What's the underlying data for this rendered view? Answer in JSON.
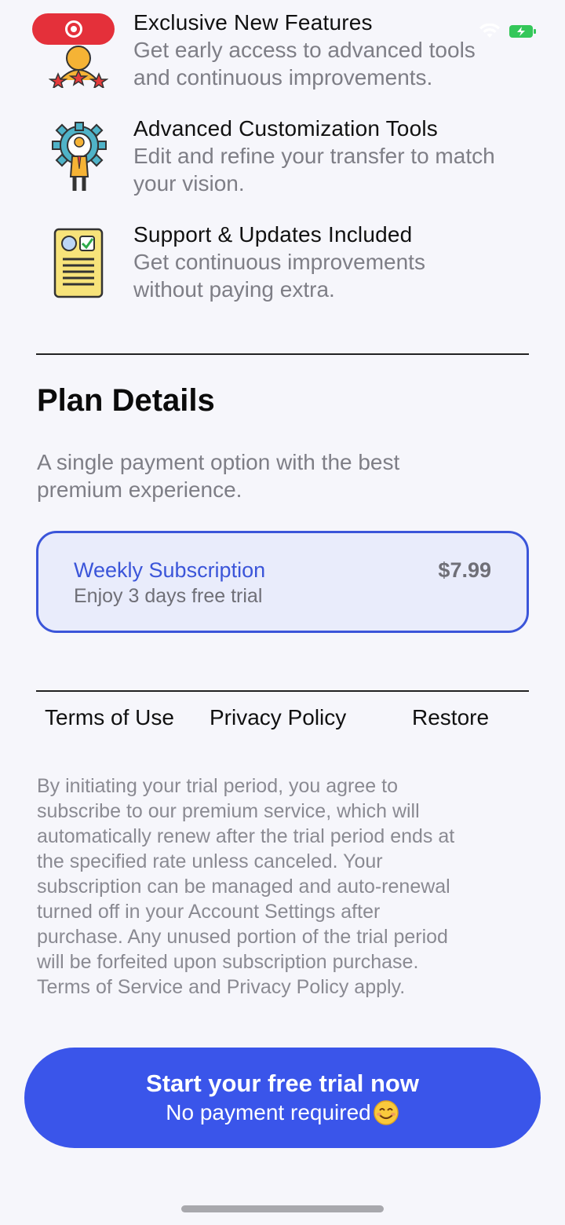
{
  "features": [
    {
      "icon": "award-person-icon",
      "title": "Exclusive New Features",
      "description_lines": [
        "Get early access to advanced tools",
        "and continuous improvements."
      ]
    },
    {
      "icon": "gear-person-icon",
      "title": "Advanced Customization Tools",
      "description_lines": [
        "Edit and refine your transfer to match",
        "your vision."
      ]
    },
    {
      "icon": "document-check-icon",
      "title": "Support & Updates Included",
      "description_lines": [
        "Get continuous improvements",
        "without paying extra."
      ]
    }
  ],
  "plan": {
    "heading": "Plan Details",
    "description_lines": [
      "A single payment option with the best",
      "premium experience."
    ],
    "card": {
      "name": "Weekly Subscription",
      "trial": "Enjoy 3 days free trial",
      "price": "$7.99"
    }
  },
  "links": {
    "terms": "Terms of Use",
    "privacy": "Privacy Policy",
    "restore": "Restore"
  },
  "legal_lines": [
    "By initiating your trial period, you agree to",
    "subscribe to our premium service, which will",
    "automatically renew after the trial period ends at",
    "the specified rate unless canceled. Your",
    "subscription can be managed and auto-renewal",
    "turned off in your Account Settings after",
    "purchase. Any unused portion of the trial period",
    "will be forfeited upon subscription purchase.",
    "Terms of Service and Privacy Policy apply."
  ],
  "cta": {
    "main": "Start your free trial now",
    "sub": "No payment required",
    "emoji_icon": "smiling-face-icon"
  },
  "colors": {
    "accent": "#3a55ea",
    "card_border": "#3b55d9",
    "card_bg": "#e9ecfb",
    "recording": "#e4303a",
    "battery": "#34c759"
  }
}
